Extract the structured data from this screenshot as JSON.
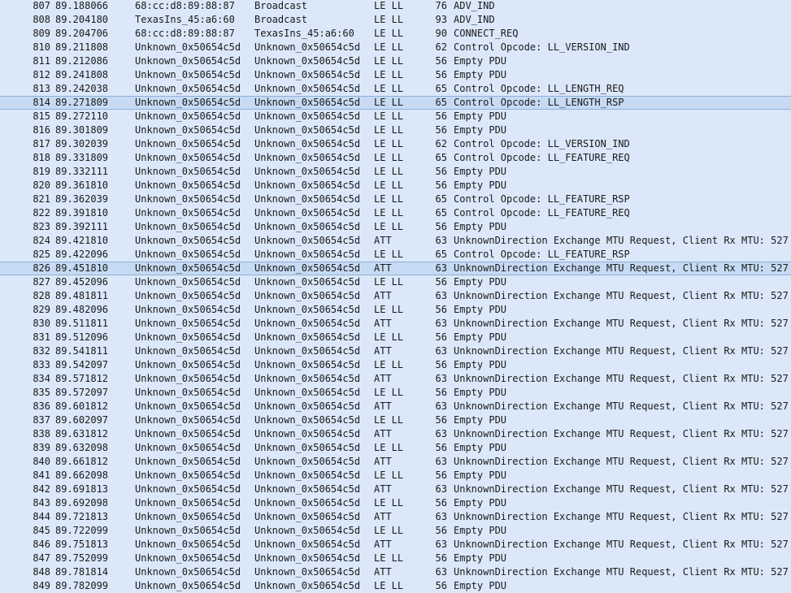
{
  "packets": [
    {
      "no": "807",
      "time": "89.188066",
      "src": "68:cc:d8:89:88:87",
      "dst": "Broadcast",
      "proto": "LE LL",
      "len": "76",
      "info": "ADV_IND"
    },
    {
      "no": "808",
      "time": "89.204180",
      "src": "TexasIns_45:a6:60",
      "dst": "Broadcast",
      "proto": "LE LL",
      "len": "93",
      "info": "ADV_IND"
    },
    {
      "no": "809",
      "time": "89.204706",
      "src": "68:cc:d8:89:88:87",
      "dst": "TexasIns_45:a6:60",
      "proto": "LE LL",
      "len": "90",
      "info": "CONNECT_REQ"
    },
    {
      "no": "810",
      "time": "89.211808",
      "src": "Unknown_0x50654c5d",
      "dst": "Unknown_0x50654c5d",
      "proto": "LE LL",
      "len": "62",
      "info": "Control Opcode: LL_VERSION_IND"
    },
    {
      "no": "811",
      "time": "89.212086",
      "src": "Unknown_0x50654c5d",
      "dst": "Unknown_0x50654c5d",
      "proto": "LE LL",
      "len": "56",
      "info": "Empty PDU"
    },
    {
      "no": "812",
      "time": "89.241808",
      "src": "Unknown_0x50654c5d",
      "dst": "Unknown_0x50654c5d",
      "proto": "LE LL",
      "len": "56",
      "info": "Empty PDU"
    },
    {
      "no": "813",
      "time": "89.242038",
      "src": "Unknown_0x50654c5d",
      "dst": "Unknown_0x50654c5d",
      "proto": "LE LL",
      "len": "65",
      "info": "Control Opcode: LL_LENGTH_REQ"
    },
    {
      "no": "814",
      "time": "89.271809",
      "src": "Unknown_0x50654c5d",
      "dst": "Unknown_0x50654c5d",
      "proto": "LE LL",
      "len": "65",
      "info": "Control Opcode: LL_LENGTH_RSP"
    },
    {
      "no": "815",
      "time": "89.272110",
      "src": "Unknown_0x50654c5d",
      "dst": "Unknown_0x50654c5d",
      "proto": "LE LL",
      "len": "56",
      "info": "Empty PDU"
    },
    {
      "no": "816",
      "time": "89.301809",
      "src": "Unknown_0x50654c5d",
      "dst": "Unknown_0x50654c5d",
      "proto": "LE LL",
      "len": "56",
      "info": "Empty PDU"
    },
    {
      "no": "817",
      "time": "89.302039",
      "src": "Unknown_0x50654c5d",
      "dst": "Unknown_0x50654c5d",
      "proto": "LE LL",
      "len": "62",
      "info": "Control Opcode: LL_VERSION_IND"
    },
    {
      "no": "818",
      "time": "89.331809",
      "src": "Unknown_0x50654c5d",
      "dst": "Unknown_0x50654c5d",
      "proto": "LE LL",
      "len": "65",
      "info": "Control Opcode: LL_FEATURE_REQ"
    },
    {
      "no": "819",
      "time": "89.332111",
      "src": "Unknown_0x50654c5d",
      "dst": "Unknown_0x50654c5d",
      "proto": "LE LL",
      "len": "56",
      "info": "Empty PDU"
    },
    {
      "no": "820",
      "time": "89.361810",
      "src": "Unknown_0x50654c5d",
      "dst": "Unknown_0x50654c5d",
      "proto": "LE LL",
      "len": "56",
      "info": "Empty PDU"
    },
    {
      "no": "821",
      "time": "89.362039",
      "src": "Unknown_0x50654c5d",
      "dst": "Unknown_0x50654c5d",
      "proto": "LE LL",
      "len": "65",
      "info": "Control Opcode: LL_FEATURE_RSP"
    },
    {
      "no": "822",
      "time": "89.391810",
      "src": "Unknown_0x50654c5d",
      "dst": "Unknown_0x50654c5d",
      "proto": "LE LL",
      "len": "65",
      "info": "Control Opcode: LL_FEATURE_REQ"
    },
    {
      "no": "823",
      "time": "89.392111",
      "src": "Unknown_0x50654c5d",
      "dst": "Unknown_0x50654c5d",
      "proto": "LE LL",
      "len": "56",
      "info": "Empty PDU"
    },
    {
      "no": "824",
      "time": "89.421810",
      "src": "Unknown_0x50654c5d",
      "dst": "Unknown_0x50654c5d",
      "proto": "ATT",
      "len": "63",
      "info": "UnknownDirection Exchange MTU Request, Client Rx MTU: 527"
    },
    {
      "no": "825",
      "time": "89.422096",
      "src": "Unknown_0x50654c5d",
      "dst": "Unknown_0x50654c5d",
      "proto": "LE LL",
      "len": "65",
      "info": "Control Opcode: LL_FEATURE_RSP"
    },
    {
      "no": "826",
      "time": "89.451810",
      "src": "Unknown_0x50654c5d",
      "dst": "Unknown_0x50654c5d",
      "proto": "ATT",
      "len": "63",
      "info": "UnknownDirection Exchange MTU Request, Client Rx MTU: 527"
    },
    {
      "no": "827",
      "time": "89.452096",
      "src": "Unknown_0x50654c5d",
      "dst": "Unknown_0x50654c5d",
      "proto": "LE LL",
      "len": "56",
      "info": "Empty PDU"
    },
    {
      "no": "828",
      "time": "89.481811",
      "src": "Unknown_0x50654c5d",
      "dst": "Unknown_0x50654c5d",
      "proto": "ATT",
      "len": "63",
      "info": "UnknownDirection Exchange MTU Request, Client Rx MTU: 527"
    },
    {
      "no": "829",
      "time": "89.482096",
      "src": "Unknown_0x50654c5d",
      "dst": "Unknown_0x50654c5d",
      "proto": "LE LL",
      "len": "56",
      "info": "Empty PDU"
    },
    {
      "no": "830",
      "time": "89.511811",
      "src": "Unknown_0x50654c5d",
      "dst": "Unknown_0x50654c5d",
      "proto": "ATT",
      "len": "63",
      "info": "UnknownDirection Exchange MTU Request, Client Rx MTU: 527"
    },
    {
      "no": "831",
      "time": "89.512096",
      "src": "Unknown_0x50654c5d",
      "dst": "Unknown_0x50654c5d",
      "proto": "LE LL",
      "len": "56",
      "info": "Empty PDU"
    },
    {
      "no": "832",
      "time": "89.541811",
      "src": "Unknown_0x50654c5d",
      "dst": "Unknown_0x50654c5d",
      "proto": "ATT",
      "len": "63",
      "info": "UnknownDirection Exchange MTU Request, Client Rx MTU: 527"
    },
    {
      "no": "833",
      "time": "89.542097",
      "src": "Unknown_0x50654c5d",
      "dst": "Unknown_0x50654c5d",
      "proto": "LE LL",
      "len": "56",
      "info": "Empty PDU"
    },
    {
      "no": "834",
      "time": "89.571812",
      "src": "Unknown_0x50654c5d",
      "dst": "Unknown_0x50654c5d",
      "proto": "ATT",
      "len": "63",
      "info": "UnknownDirection Exchange MTU Request, Client Rx MTU: 527"
    },
    {
      "no": "835",
      "time": "89.572097",
      "src": "Unknown_0x50654c5d",
      "dst": "Unknown_0x50654c5d",
      "proto": "LE LL",
      "len": "56",
      "info": "Empty PDU"
    },
    {
      "no": "836",
      "time": "89.601812",
      "src": "Unknown_0x50654c5d",
      "dst": "Unknown_0x50654c5d",
      "proto": "ATT",
      "len": "63",
      "info": "UnknownDirection Exchange MTU Request, Client Rx MTU: 527"
    },
    {
      "no": "837",
      "time": "89.602097",
      "src": "Unknown_0x50654c5d",
      "dst": "Unknown_0x50654c5d",
      "proto": "LE LL",
      "len": "56",
      "info": "Empty PDU"
    },
    {
      "no": "838",
      "time": "89.631812",
      "src": "Unknown_0x50654c5d",
      "dst": "Unknown_0x50654c5d",
      "proto": "ATT",
      "len": "63",
      "info": "UnknownDirection Exchange MTU Request, Client Rx MTU: 527"
    },
    {
      "no": "839",
      "time": "89.632098",
      "src": "Unknown_0x50654c5d",
      "dst": "Unknown_0x50654c5d",
      "proto": "LE LL",
      "len": "56",
      "info": "Empty PDU"
    },
    {
      "no": "840",
      "time": "89.661812",
      "src": "Unknown_0x50654c5d",
      "dst": "Unknown_0x50654c5d",
      "proto": "ATT",
      "len": "63",
      "info": "UnknownDirection Exchange MTU Request, Client Rx MTU: 527"
    },
    {
      "no": "841",
      "time": "89.662098",
      "src": "Unknown_0x50654c5d",
      "dst": "Unknown_0x50654c5d",
      "proto": "LE LL",
      "len": "56",
      "info": "Empty PDU"
    },
    {
      "no": "842",
      "time": "89.691813",
      "src": "Unknown_0x50654c5d",
      "dst": "Unknown_0x50654c5d",
      "proto": "ATT",
      "len": "63",
      "info": "UnknownDirection Exchange MTU Request, Client Rx MTU: 527"
    },
    {
      "no": "843",
      "time": "89.692098",
      "src": "Unknown_0x50654c5d",
      "dst": "Unknown_0x50654c5d",
      "proto": "LE LL",
      "len": "56",
      "info": "Empty PDU"
    },
    {
      "no": "844",
      "time": "89.721813",
      "src": "Unknown_0x50654c5d",
      "dst": "Unknown_0x50654c5d",
      "proto": "ATT",
      "len": "63",
      "info": "UnknownDirection Exchange MTU Request, Client Rx MTU: 527"
    },
    {
      "no": "845",
      "time": "89.722099",
      "src": "Unknown_0x50654c5d",
      "dst": "Unknown_0x50654c5d",
      "proto": "LE LL",
      "len": "56",
      "info": "Empty PDU"
    },
    {
      "no": "846",
      "time": "89.751813",
      "src": "Unknown_0x50654c5d",
      "dst": "Unknown_0x50654c5d",
      "proto": "ATT",
      "len": "63",
      "info": "UnknownDirection Exchange MTU Request, Client Rx MTU: 527"
    },
    {
      "no": "847",
      "time": "89.752099",
      "src": "Unknown_0x50654c5d",
      "dst": "Unknown_0x50654c5d",
      "proto": "LE LL",
      "len": "56",
      "info": "Empty PDU"
    },
    {
      "no": "848",
      "time": "89.781814",
      "src": "Unknown_0x50654c5d",
      "dst": "Unknown_0x50654c5d",
      "proto": "ATT",
      "len": "63",
      "info": "UnknownDirection Exchange MTU Request, Client Rx MTU: 527"
    },
    {
      "no": "849",
      "time": "89.782099",
      "src": "Unknown_0x50654c5d",
      "dst": "Unknown_0x50654c5d",
      "proto": "LE LL",
      "len": "56",
      "info": "Empty PDU"
    }
  ],
  "highlighted_rows": [
    "814",
    "826"
  ],
  "colors": {
    "row_background": "#dbe8fa",
    "highlight_background": "#c6dbf3",
    "highlight_border": "#8fb0d8",
    "text": "#1a1a1a"
  }
}
